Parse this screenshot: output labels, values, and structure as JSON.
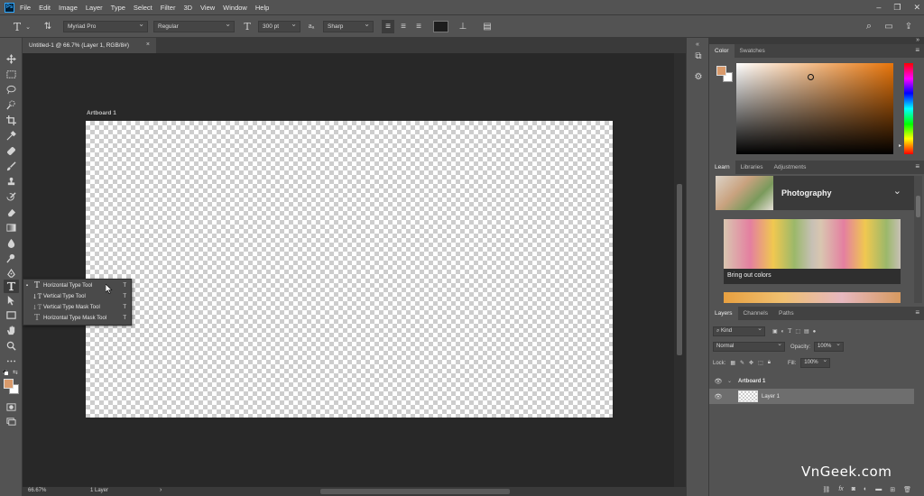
{
  "menubar": {
    "logo": "Ps",
    "items": [
      "File",
      "Edit",
      "Image",
      "Layer",
      "Type",
      "Select",
      "Filter",
      "3D",
      "View",
      "Window",
      "Help"
    ]
  },
  "options": {
    "font_family": "Myriad Pro",
    "font_style": "Regular",
    "font_size": "300 pt",
    "antialias_label": "aₐ",
    "antialias": "Sharp"
  },
  "document": {
    "tab_title": "Untitled-1 @ 66.7% (Layer 1, RGB/8#)",
    "tab_close": "×",
    "artboard_label": "Artboard 1",
    "zoom": "66.67%",
    "status_info": "1 Layer"
  },
  "type_flyout": {
    "items": [
      {
        "label": "Horizontal Type Tool",
        "key": "T",
        "glyph": "T",
        "current": true
      },
      {
        "label": "Vertical Type Tool",
        "key": "T",
        "glyph": "↓T",
        "current": false
      },
      {
        "label": "Vertical Type Mask Tool",
        "key": "T",
        "glyph": "↓T",
        "current": false
      },
      {
        "label": "Horizontal Type Mask Tool",
        "key": "T",
        "glyph": "T",
        "current": false
      }
    ]
  },
  "color_panel": {
    "tabs": [
      "Color",
      "Swatches"
    ],
    "foreground": "#d99a6b",
    "background": "#ffffff",
    "hue_base": "#e8750a"
  },
  "learn_panel": {
    "tabs": [
      "Learn",
      "Libraries",
      "Adjustments"
    ],
    "topic": "Photography",
    "card_caption": "Bring out colors"
  },
  "layers_panel": {
    "tabs": [
      "Layers",
      "Channels",
      "Paths"
    ],
    "filter_kind": "Kind",
    "blend_mode": "Normal",
    "opacity_label": "Opacity:",
    "opacity": "100%",
    "lock_label": "Lock:",
    "fill_label": "Fill:",
    "fill": "100%",
    "layers": [
      {
        "name": "Artboard 1",
        "type": "artboard",
        "selected": false
      },
      {
        "name": "Layer 1",
        "type": "layer",
        "selected": true
      }
    ],
    "footer_fx": "fx"
  },
  "watermark": "VnGeek.com"
}
